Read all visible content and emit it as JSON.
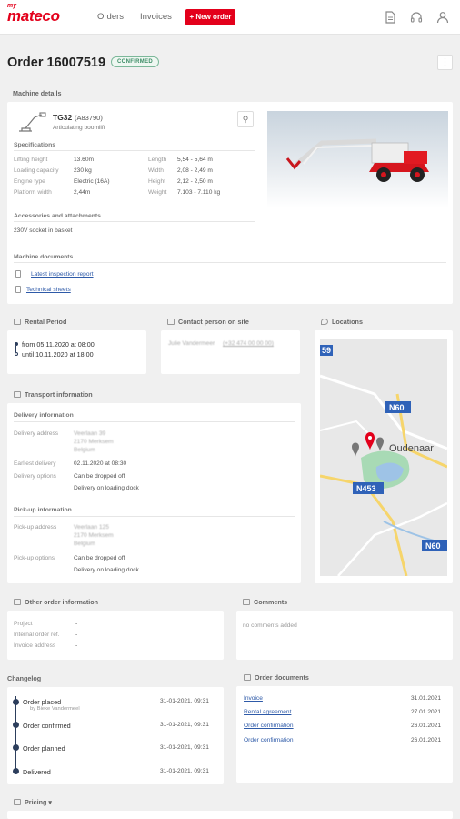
{
  "header": {
    "logo_prefix": "my",
    "logo_name": "mateco",
    "nav": [
      "Orders",
      "Invoices"
    ],
    "new_order": "+ New order",
    "icons": [
      "document-icon",
      "headset-icon",
      "user-icon"
    ]
  },
  "order": {
    "title": "Order 16007519",
    "status": "CONFIRMED",
    "more": "⋮"
  },
  "machine": {
    "section": "Machine details",
    "model": "TG32",
    "code": "(A83790)",
    "type": "Articulating boomlift",
    "specs_title": "Specifications",
    "specs_left": [
      {
        "label": "Lifting height",
        "value": "13.60m"
      },
      {
        "label": "Loading capacity",
        "value": "230 kg"
      },
      {
        "label": "Engine type",
        "value": "Electric (16A)"
      },
      {
        "label": "Platform width",
        "value": "2,44m"
      }
    ],
    "specs_right": [
      {
        "label": "Length",
        "value": "5,54 - 5,64 m"
      },
      {
        "label": "Width",
        "value": "2,08 - 2,49 m"
      },
      {
        "label": "Height",
        "value": "2,12 - 2,50 m"
      },
      {
        "label": "Weight",
        "value": "7.103 - 7.110 kg"
      }
    ],
    "accessories_title": "Accessories and attachments",
    "accessories": "230V socket in basket",
    "documents_title": "Machine documents",
    "documents": [
      "Latest inspection report",
      "Technical sheets"
    ]
  },
  "rental": {
    "title": "Rental Period",
    "from": "from 05.11.2020 at 08:00",
    "until": "until 10.11.2020 at 18:00"
  },
  "contact": {
    "title": "Contact person on site",
    "name": "Julie Vandermeer",
    "phone": "(+32 474 00 00 00)"
  },
  "locations": {
    "title": "Locations",
    "labels": [
      "N60",
      "N453",
      "N60",
      "Oudenaar",
      "59"
    ]
  },
  "transport": {
    "title": "Transport information",
    "delivery_title": "Delivery information",
    "delivery_address_label": "Delivery address",
    "delivery_address": [
      "Veerlaan 39",
      "2170 Merksem",
      "Belgium"
    ],
    "earliest_label": "Earliest delivery",
    "earliest": "02.11.2020 at 08:30",
    "delivery_options_label": "Delivery options",
    "delivery_options": [
      "Can be dropped off",
      "Delivery on loading dock"
    ],
    "pickup_title": "Pick-up information",
    "pickup_address_label": "Pick-up address",
    "pickup_address": [
      "Veerlaan 125",
      "2170 Merksem",
      "Belgium"
    ],
    "pickup_options_label": "Pick-up options",
    "pickup_options": [
      "Can be dropped off",
      "Delivery on loading dock"
    ]
  },
  "other": {
    "title": "Other order information",
    "rows": [
      {
        "label": "Project",
        "value": "-"
      },
      {
        "label": "Internal order ref.",
        "value": "-"
      },
      {
        "label": "Invoice address",
        "value": "-"
      }
    ]
  },
  "comments": {
    "title": "Comments",
    "empty": "no comments added"
  },
  "changelog": {
    "title": "Changelog",
    "items": [
      {
        "label": "Order placed",
        "by": "by Bieke Vandermeel",
        "date": "31-01-2021, 09:31"
      },
      {
        "label": "Order confirmed",
        "by": "",
        "date": "31-01-2021, 09:31"
      },
      {
        "label": "Order planned",
        "by": "",
        "date": "31-01-2021, 09:31"
      },
      {
        "label": "Delivered",
        "by": "",
        "date": "31-01-2021, 09:31"
      }
    ]
  },
  "order_documents": {
    "title": "Order documents",
    "items": [
      {
        "name": "Invoice",
        "date": "31.01.2021"
      },
      {
        "name": "Rental agreement",
        "date": "27.01.2021"
      },
      {
        "name": "Order confirmation",
        "date": "26.01.2021"
      },
      {
        "name": "Order confirmation",
        "date": "26.01.2021"
      }
    ]
  },
  "pricing": {
    "title": "Pricing",
    "caret": "▾"
  },
  "colors": {
    "brand": "#e3001b",
    "accent_blue": "#2e5aa8",
    "confirmed": "#3c8c66"
  }
}
